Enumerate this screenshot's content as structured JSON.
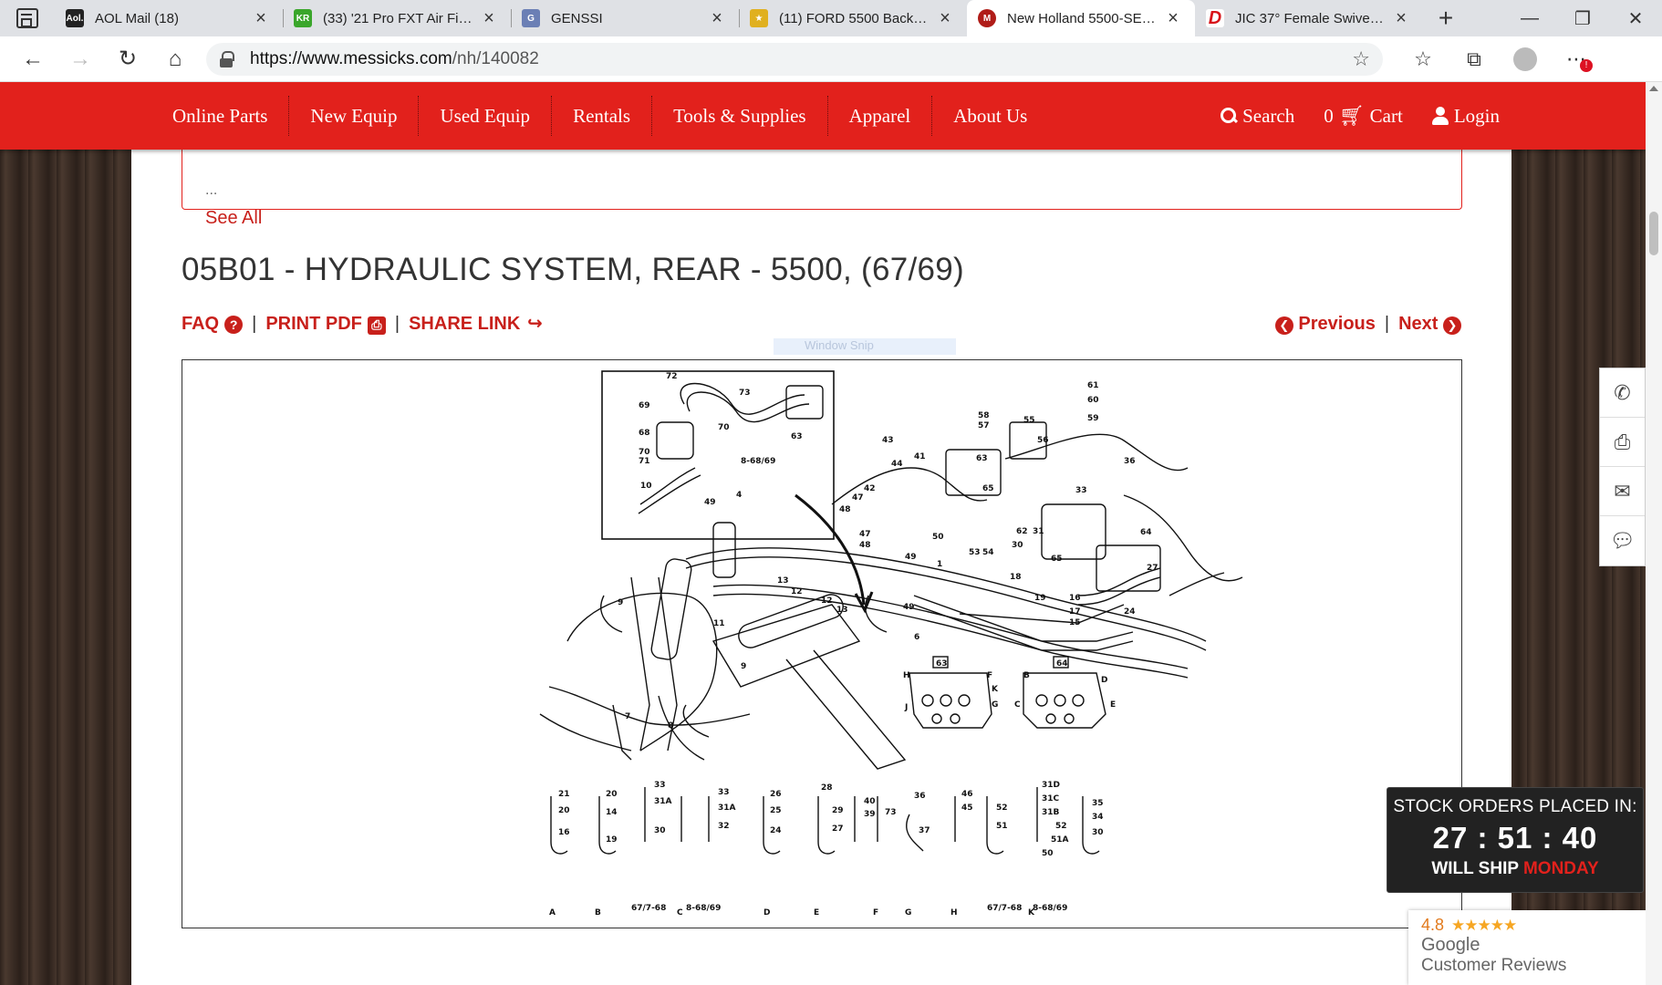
{
  "browser": {
    "tabs": [
      {
        "title": "AOL Mail (18)",
        "favicon_text": "Aol.",
        "favicon_color": "#222222",
        "active": false
      },
      {
        "title": "(33) '21 Pro FXT Air Filter",
        "favicon_text": "KR",
        "favicon_color": "#3aa62b",
        "active": false
      },
      {
        "title": "GENSSI",
        "favicon_text": "G",
        "favicon_color": "#6b7fb5",
        "active": false
      },
      {
        "title": "(11) FORD 5500 Backhoe",
        "favicon_text": "★",
        "favicon_color": "#e0b020",
        "active": false
      },
      {
        "title": "New Holland 5500-SERIES",
        "favicon_text": "M",
        "favicon_color": "#b01c18",
        "active": true
      },
      {
        "title": "JIC 37° Female Swivel (FJX",
        "favicon_text": "D",
        "favicon_color": "#d8141a",
        "active": false
      }
    ],
    "url_host": "https://www.messicks.com",
    "url_path": "/nh/140082"
  },
  "nav": {
    "menu": [
      "Online Parts",
      "New Equip",
      "Used Equip",
      "Rentals",
      "Tools & Supplies",
      "Apparel",
      "About Us"
    ],
    "search": "Search",
    "cart_count": "0",
    "cart": "Cart",
    "login": "Login"
  },
  "prev_section": {
    "ellipsis": "...",
    "see_all": "See All"
  },
  "page": {
    "title": "05B01 - HYDRAULIC SYSTEM, REAR - 5500, (67/69)",
    "faq": "FAQ",
    "print_pdf": "PRINT PDF",
    "share_link": "SHARE LINK",
    "previous": "Previous",
    "next": "Next",
    "snip_label": "Window Snip"
  },
  "diagram": {
    "callouts": [
      "72",
      "73",
      "69",
      "70",
      "68",
      "63",
      "70",
      "71",
      "8-68/69",
      "10",
      "61",
      "60",
      "59",
      "58",
      "57",
      "55",
      "56",
      "43",
      "41",
      "36",
      "44",
      "63",
      "42",
      "47",
      "65",
      "33",
      "48",
      "49",
      "4",
      "47",
      "48",
      "50",
      "62",
      "31",
      "64",
      "53",
      "54",
      "30",
      "65",
      "18",
      "27",
      "19",
      "16",
      "17",
      "15",
      "24",
      "49",
      "1",
      "13",
      "12",
      "12",
      "13",
      "6",
      "9",
      "11",
      "63",
      "64",
      "7",
      "9",
      "8"
    ],
    "inset_labels": [
      "A",
      "B",
      "C",
      "D",
      "E",
      "F",
      "G",
      "H",
      "J",
      "K"
    ],
    "small_notes": [
      "67/7-68",
      "8-68/69"
    ]
  },
  "stock": {
    "title": "STOCK ORDERS PLACED IN:",
    "timer": "27 : 51 : 40",
    "ship_prefix": "WILL SHIP",
    "ship_day": "MONDAY"
  },
  "reviews": {
    "rating": "4.8",
    "stars": "★★★★★",
    "brand": "Google",
    "label": "Customer Reviews"
  },
  "side_tools": [
    "phone-icon",
    "print-icon",
    "mail-icon",
    "chat-icon"
  ]
}
